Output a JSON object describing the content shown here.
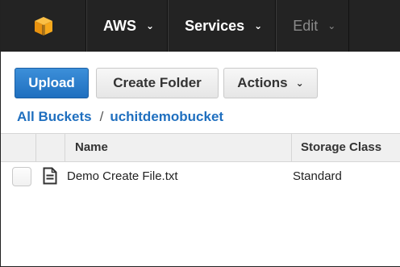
{
  "nav": {
    "logo_icon": "aws-cube-icon",
    "logo_color": "#f7a81b",
    "items": [
      {
        "label": "AWS",
        "chevron": "⌄"
      },
      {
        "label": "Services",
        "chevron": "⌄"
      },
      {
        "label": "Edit",
        "chevron": "⌄"
      }
    ]
  },
  "toolbar": {
    "upload_label": "Upload",
    "create_folder_label": "Create Folder",
    "actions_label": "Actions",
    "actions_chevron": "⌄",
    "primary_color": "#1f6fbf"
  },
  "breadcrumb": {
    "root": "All Buckets",
    "separator": "/",
    "bucket": "uchitdemobucket"
  },
  "table": {
    "columns": [
      "Name",
      "Storage Class"
    ],
    "rows": [
      {
        "name": "Demo Create File.txt",
        "storage_class": "Standard",
        "icon": "file-text-icon"
      }
    ]
  }
}
